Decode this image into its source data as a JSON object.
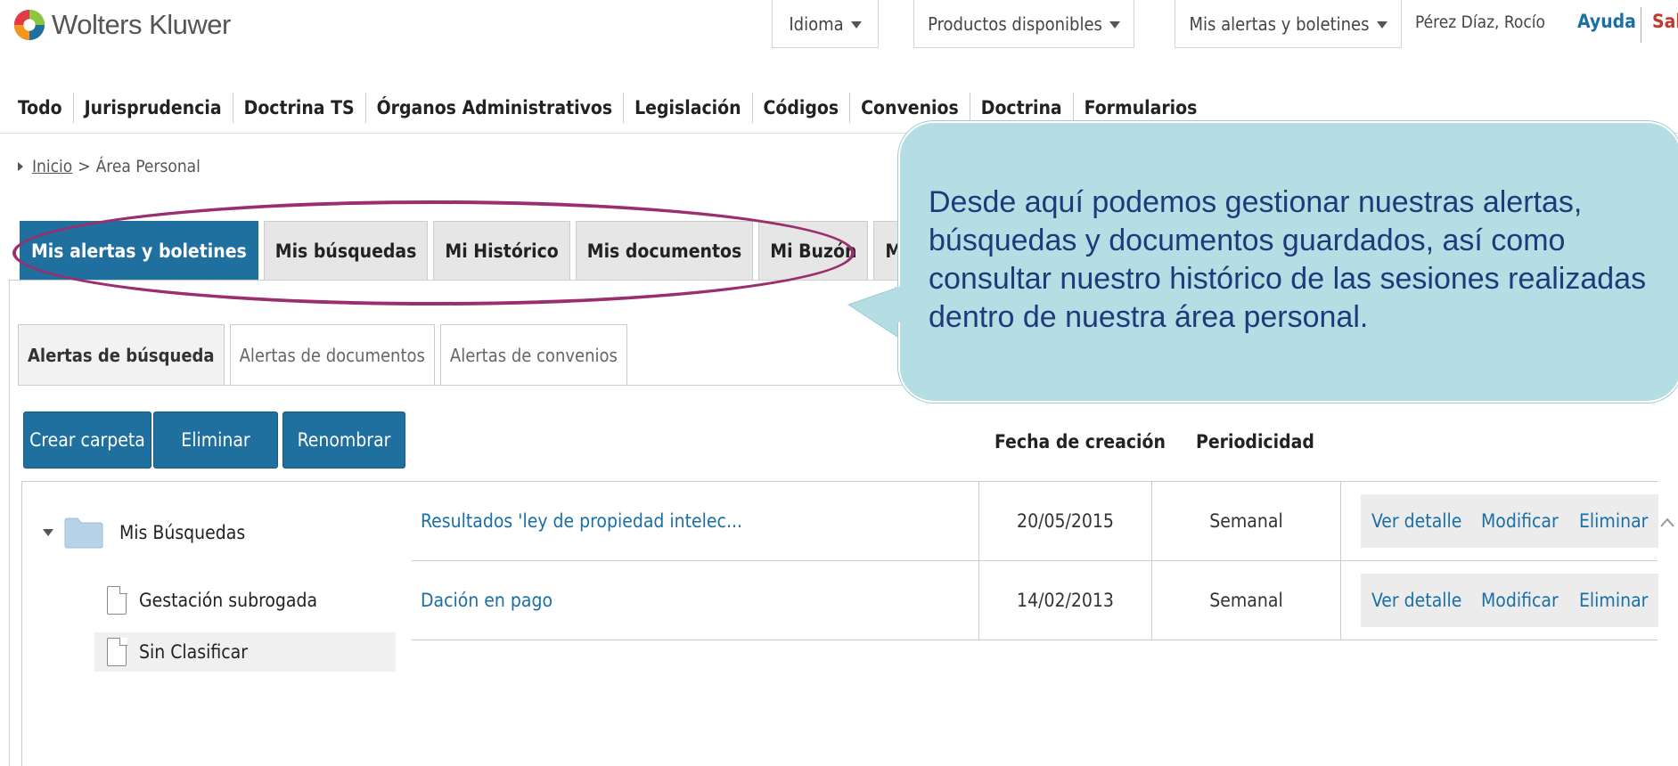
{
  "header": {
    "logo_text": "Wolters Kluwer",
    "dropdowns": [
      "Idioma",
      "Productos disponibles",
      "Mis alertas y boletines"
    ],
    "user": "Pérez Díaz, Rocío",
    "help": "Ayuda",
    "exit": "Sal"
  },
  "nav": [
    "Todo",
    "Jurisprudencia",
    "Doctrina TS",
    "Órganos Administrativos",
    "Legislación",
    "Códigos",
    "Convenios",
    "Doctrina",
    "Formularios"
  ],
  "breadcrumb": {
    "home": "Inicio",
    "separator": ">",
    "current": "Área Personal"
  },
  "main_tabs": [
    "Mis alertas y boletines",
    "Mis búsquedas",
    "Mi Histórico",
    "Mis documentos",
    "Mi Buzón",
    "Mis datos"
  ],
  "sub_tabs": [
    "Alertas de búsqueda",
    "Alertas de documentos",
    "Alertas de convenios"
  ],
  "buttons": {
    "create": "Crear carpeta",
    "delete": "Eliminar",
    "rename": "Renombrar"
  },
  "columns": {
    "date": "Fecha de creación",
    "period": "Periodicidad"
  },
  "tree": {
    "root": "Mis Búsquedas",
    "children": [
      "Gestación subrogada",
      "Sin Clasificar"
    ]
  },
  "rows": [
    {
      "title": "Resultados 'ley de propiedad intelec...",
      "date": "20/05/2015",
      "period": "Semanal",
      "actions": [
        "Ver detalle",
        "Modificar",
        "Eliminar"
      ]
    },
    {
      "title": "Dación en pago",
      "date": "14/02/2013",
      "period": "Semanal",
      "actions": [
        "Ver detalle",
        "Modificar",
        "Eliminar"
      ]
    }
  ],
  "callout": "Desde aquí podemos gestionar nuestras alertas, búsquedas y documentos guardados, así como consultar nuestro histórico de las sesiones realizadas dentro de nuestra área personal.",
  "colors": {
    "accent": "#1f6f9f",
    "link": "#1a6fa6",
    "highlight_oval": "#9b2e6f",
    "callout_bg": "#b4dde4"
  }
}
